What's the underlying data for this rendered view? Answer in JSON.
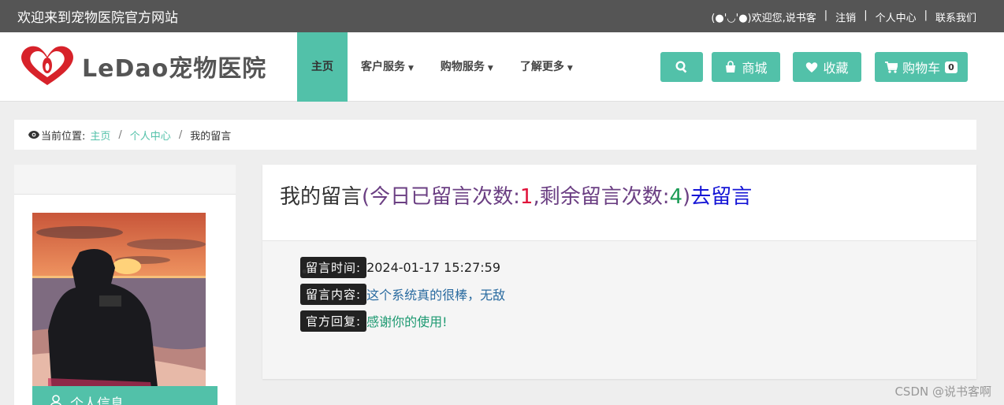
{
  "topbar": {
    "welcome": "欢迎来到宠物医院官方网站",
    "user_greeting": "(●'◡'●)欢迎您,说书客",
    "logout": "注销",
    "personal_center": "个人中心",
    "contact": "联系我们"
  },
  "header": {
    "logo_text": "LeDao宠物医院",
    "nav": {
      "home": "主页",
      "customer_service": "客户服务",
      "shopping_service": "购物服务",
      "learn_more": "了解更多"
    },
    "buttons": {
      "mall": "商城",
      "favorites": "收藏",
      "cart": "购物车",
      "cart_count": "0"
    }
  },
  "breadcrumb": {
    "prefix": "当前位置:",
    "home": "主页",
    "center": "个人中心",
    "current": "我的留言"
  },
  "sidebar": {
    "personal_info": "个人信息"
  },
  "panel": {
    "title_main": "我的留言",
    "title_open": "(今日已留言次数:",
    "today_count": "1",
    "title_mid": ",剩余留言次数:",
    "remaining_count": "4",
    "title_close": ")",
    "title_link": "去留言",
    "message": {
      "time_label": "留言时间:",
      "time_value": "2024-01-17 15:27:59",
      "content_label": "留言内容:",
      "content_value": "这个系统真的很棒，无敌",
      "reply_label": "官方回复:",
      "reply_value": "感谢你的使用!"
    }
  },
  "watermark": "CSDN @说书客啊",
  "colors": {
    "accent": "#52c1a9",
    "topbar": "#555555"
  }
}
